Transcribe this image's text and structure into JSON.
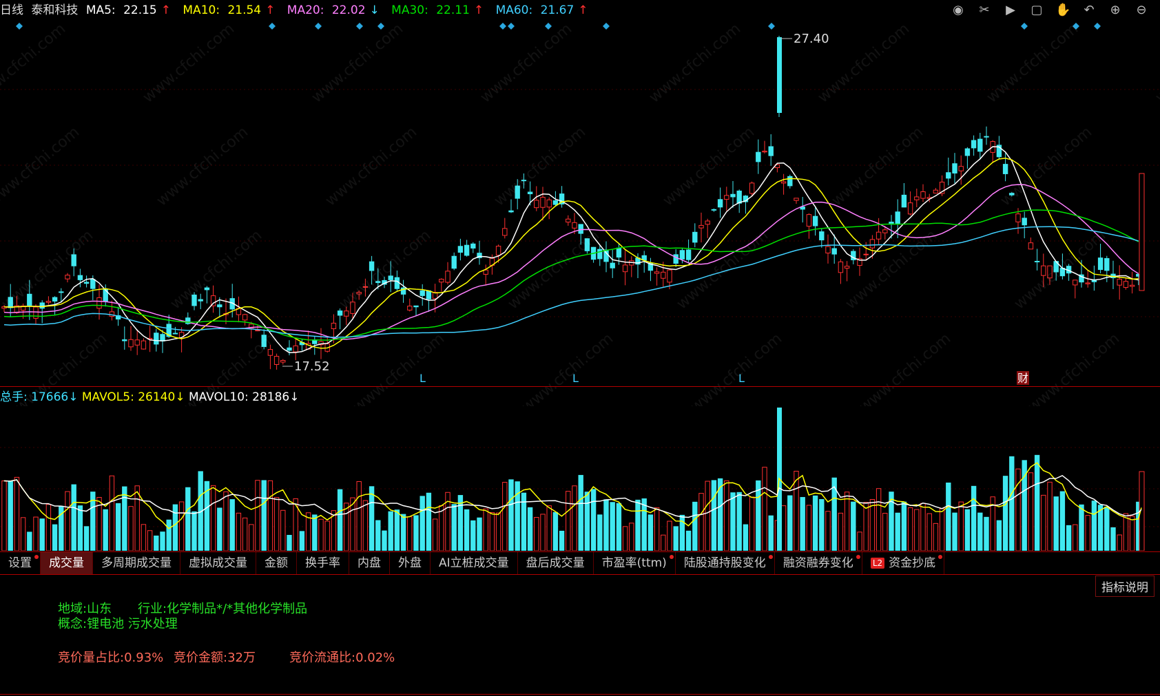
{
  "header": {
    "period": "日线",
    "stock_name": "泰和科技",
    "ma5": {
      "label": "MA5:",
      "value": "22.15",
      "arrow": "↑",
      "color": "#ffffff"
    },
    "ma10": {
      "label": "MA10:",
      "value": "21.54",
      "arrow": "↑",
      "color": "#ffff00"
    },
    "ma20": {
      "label": "MA20:",
      "value": "22.02",
      "arrow": "↓",
      "color": "#ff80ff"
    },
    "ma30": {
      "label": "MA30:",
      "value": "22.11",
      "arrow": "↑",
      "color": "#00e000"
    },
    "ma60": {
      "label": "MA60:",
      "value": "21.67",
      "arrow": "↑",
      "color": "#40d0ff"
    }
  },
  "toolbar_icons": [
    "eye-icon",
    "scissors-icon",
    "play-icon",
    "lock-icon",
    "hand-icon",
    "undo-icon",
    "zoom-in-icon",
    "zoom-out-icon"
  ],
  "price_chart": {
    "high_label": "27.40",
    "low_label": "17.52",
    "markers": [
      "L",
      "L",
      "L",
      "财"
    ]
  },
  "volume_header": {
    "total": {
      "label": "总手:",
      "value": "17666",
      "arrow": "↓"
    },
    "mavol5": {
      "label": "MAVOL5:",
      "value": "26140",
      "arrow": "↓"
    },
    "mavol10": {
      "label": "MAVOL10:",
      "value": "28186",
      "arrow": "↓"
    }
  },
  "tabs": [
    {
      "label": "设置",
      "dot": true
    },
    {
      "label": "成交量",
      "dot": false,
      "active": true
    },
    {
      "label": "多周期成交量",
      "dot": false
    },
    {
      "label": "虚拟成交量",
      "dot": false
    },
    {
      "label": "金额",
      "dot": false
    },
    {
      "label": "换手率",
      "dot": false
    },
    {
      "label": "内盘",
      "dot": false
    },
    {
      "label": "外盘",
      "dot": false
    },
    {
      "label": "AI立桩成交量",
      "dot": false
    },
    {
      "label": "盘后成交量",
      "dot": false
    },
    {
      "label": "市盈率(ttm)",
      "dot": true
    },
    {
      "label": "陆股通持股变化",
      "dot": true
    },
    {
      "label": "融资融券变化",
      "dot": true
    },
    {
      "label": "资金抄底",
      "dot": true,
      "badge": "L2"
    }
  ],
  "help_button": "指标说明",
  "info": {
    "region": "地域:山东",
    "industry": "行业:化学制品*/*其他化学制品",
    "concept": "概念:锂电池 污水处理",
    "auction_ratio": "竞价量占比:0.93%",
    "auction_amount": "竞价金额:32万",
    "auction_float": "竞价流通比:0.02%"
  },
  "watermark": "www.cfchi.com"
}
